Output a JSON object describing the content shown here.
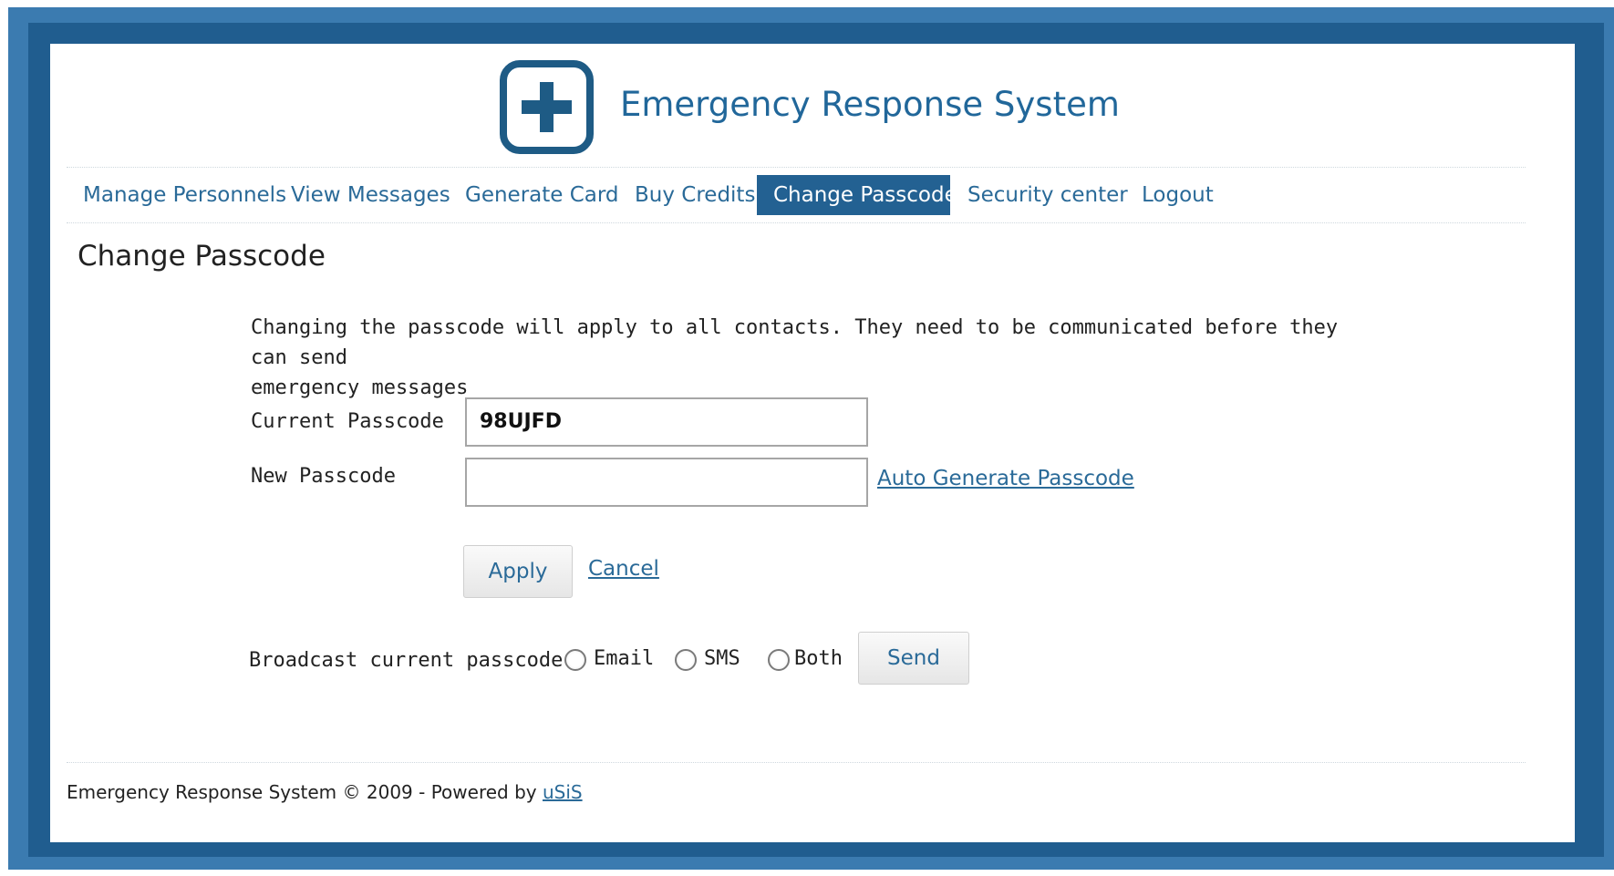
{
  "header": {
    "site_title": "Emergency Response System",
    "logo_icon": "plus-cross-icon"
  },
  "nav": {
    "items": [
      {
        "label": "Manage Personnels",
        "active": false
      },
      {
        "label": "View Messages",
        "active": false
      },
      {
        "label": "Generate Card",
        "active": false
      },
      {
        "label": "Buy Credits",
        "active": false
      },
      {
        "label": "Change Passcode",
        "active": true
      },
      {
        "label": "Security center",
        "active": false
      },
      {
        "label": "Logout",
        "active": false
      }
    ]
  },
  "main": {
    "page_title": "Change Passcode",
    "intro_line1": "Changing the passcode will apply to all contacts. They need to be communicated before they can send",
    "intro_line2": "emergency messages",
    "current_passcode_label": "Current Passcode",
    "current_passcode_value": "98UJFD",
    "new_passcode_label": "New Passcode",
    "new_passcode_value": "",
    "auto_generate_link": "Auto Generate Passcode",
    "apply_button": "Apply",
    "cancel_link": "Cancel",
    "broadcast_label": "Broadcast current passcode :",
    "broadcast_options": [
      "Email",
      "SMS",
      "Both"
    ],
    "send_button": "Send"
  },
  "footer": {
    "text": "Emergency Response System © 2009 - Powered by ",
    "link": "uSiS"
  },
  "colors": {
    "frame_outer": "#3b7bb0",
    "frame_inner": "#205d8f",
    "accent": "#236192",
    "link": "#2a6a98"
  }
}
